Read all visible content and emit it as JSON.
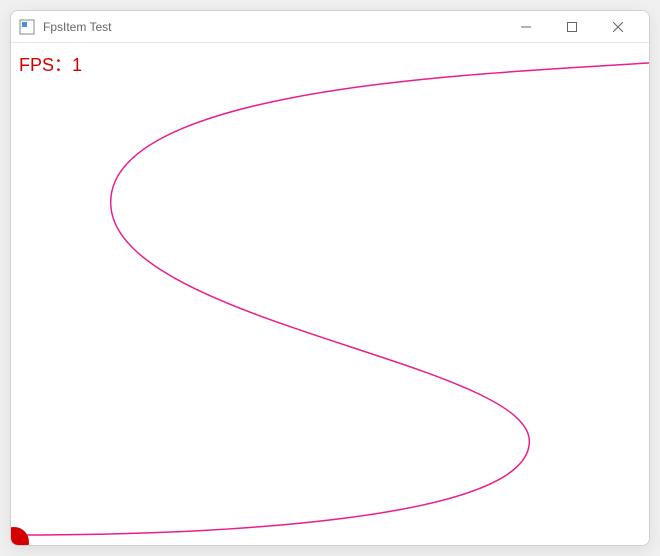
{
  "window": {
    "title": "FpsItem Test"
  },
  "fps": {
    "label": "FPS",
    "value": 1,
    "separator": "："
  },
  "colors": {
    "fps_text": "#d40000",
    "curve": "#e91e8c",
    "ball": "#d40000"
  }
}
